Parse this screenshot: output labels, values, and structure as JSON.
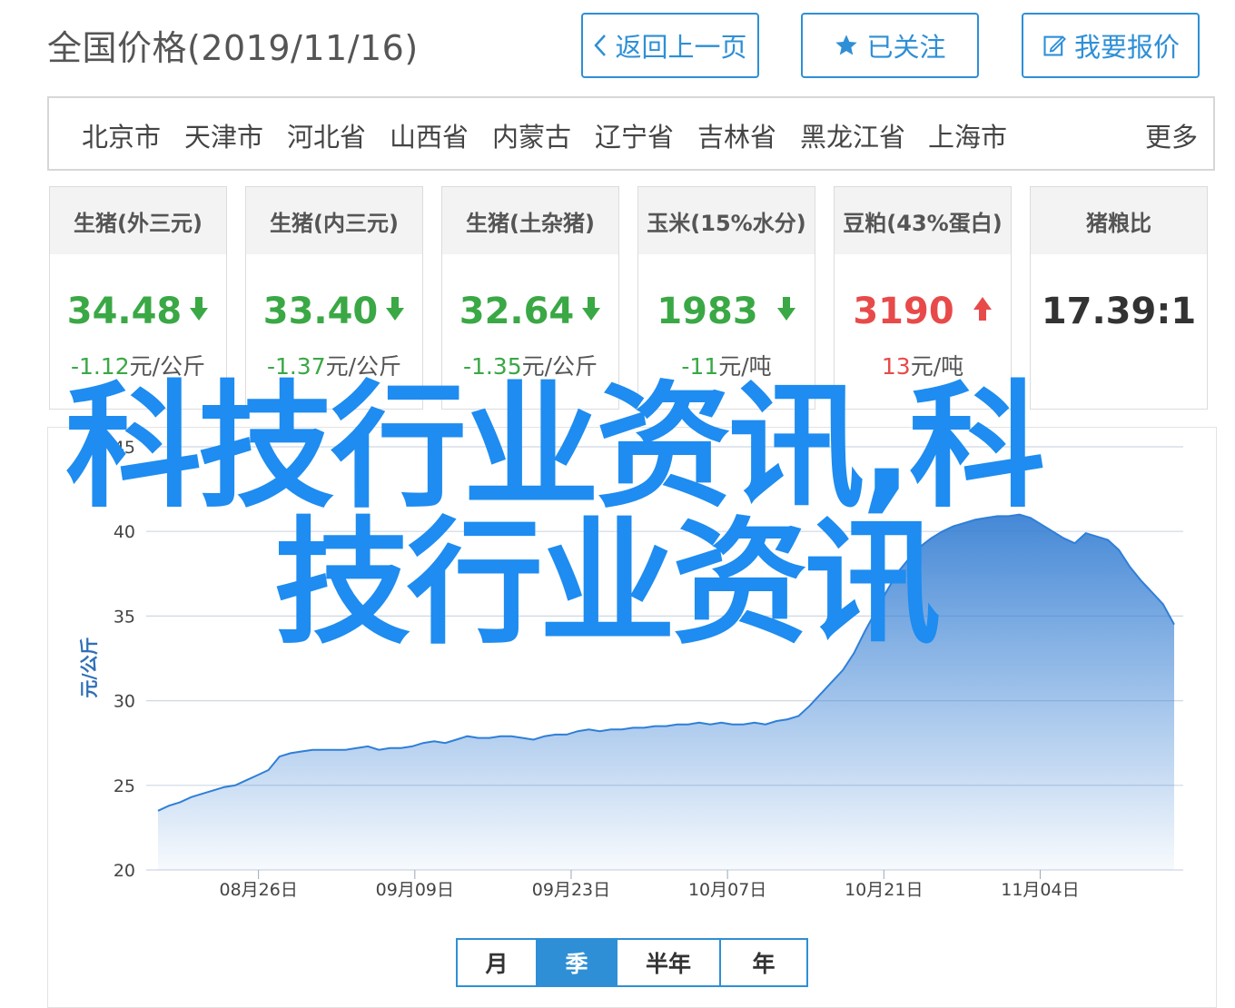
{
  "header": {
    "title": "全国价格(2019/11/16)",
    "back_label": "返回上一页",
    "follow_label": "已关注",
    "report_label": "我要报价"
  },
  "regions": {
    "items": [
      "北京市",
      "天津市",
      "河北省",
      "山西省",
      "内蒙古",
      "辽宁省",
      "吉林省",
      "黑龙江省",
      "上海市"
    ],
    "more": "更多"
  },
  "cards": [
    {
      "title": "生猪(外三元)",
      "price": "34.48",
      "direction": "down",
      "change_num": "-1.12",
      "change_unit": "元/公斤"
    },
    {
      "title": "生猪(内三元)",
      "price": "33.40",
      "direction": "down",
      "change_num": "-1.37",
      "change_unit": "元/公斤"
    },
    {
      "title": "生猪(土杂猪)",
      "price": "32.64",
      "direction": "down",
      "change_num": "-1.35",
      "change_unit": "元/公斤"
    },
    {
      "title": "玉米(15%水分)",
      "price": "1983",
      "direction": "down",
      "change_num": "-11",
      "change_unit": "元/吨"
    },
    {
      "title": "豆粕(43%蛋白)",
      "price": "3190",
      "direction": "up",
      "change_num": "13",
      "change_unit": "元/吨"
    },
    {
      "title": "猪粮比",
      "price": "17.39:1",
      "direction": "none",
      "change_num": "",
      "change_unit": ""
    }
  ],
  "colors": {
    "accent": "#2e8fd6",
    "up": "#e84a4a",
    "down": "#3aa845",
    "area": "#3b82d4"
  },
  "chart_data": {
    "type": "area",
    "title": "",
    "xlabel": "",
    "ylabel": "元/公斤",
    "ylim": [
      20,
      45
    ],
    "yticks": [
      20,
      25,
      30,
      35,
      40,
      45
    ],
    "xticks": [
      "08月26日",
      "09月09日",
      "09月23日",
      "10月07日",
      "10月21日",
      "11月04日"
    ],
    "x_start": "2019-08-17",
    "x_end": "2019-11-16",
    "grid": true,
    "series": [
      {
        "values": [
          23.5,
          23.8,
          24.0,
          24.3,
          24.5,
          24.7,
          24.9,
          25.0,
          25.3,
          25.6,
          25.9,
          26.7,
          26.9,
          27.0,
          27.1,
          27.1,
          27.1,
          27.1,
          27.2,
          27.3,
          27.1,
          27.2,
          27.2,
          27.3,
          27.5,
          27.6,
          27.5,
          27.7,
          27.9,
          27.8,
          27.8,
          27.9,
          27.9,
          27.8,
          27.7,
          27.9,
          28.0,
          28.0,
          28.2,
          28.3,
          28.2,
          28.3,
          28.3,
          28.4,
          28.4,
          28.5,
          28.5,
          28.6,
          28.6,
          28.7,
          28.6,
          28.7,
          28.6,
          28.6,
          28.7,
          28.6,
          28.8,
          28.9,
          29.1,
          29.7,
          30.4,
          31.1,
          31.8,
          32.8,
          34.1,
          35.3,
          36.5,
          37.6,
          38.4,
          39.1,
          39.6,
          40.0,
          40.3,
          40.5,
          40.7,
          40.8,
          40.9,
          40.9,
          41.0,
          40.8,
          40.4,
          40.0,
          39.6,
          39.3,
          39.9,
          39.7,
          39.5,
          38.9,
          37.9,
          37.1,
          36.4,
          35.7,
          34.5
        ]
      }
    ]
  },
  "tabs": {
    "items": [
      "月",
      "季",
      "半年",
      "年"
    ],
    "active": "季"
  },
  "watermark": {
    "line1": "科技行业资讯,科",
    "line2": "技行业资讯"
  }
}
